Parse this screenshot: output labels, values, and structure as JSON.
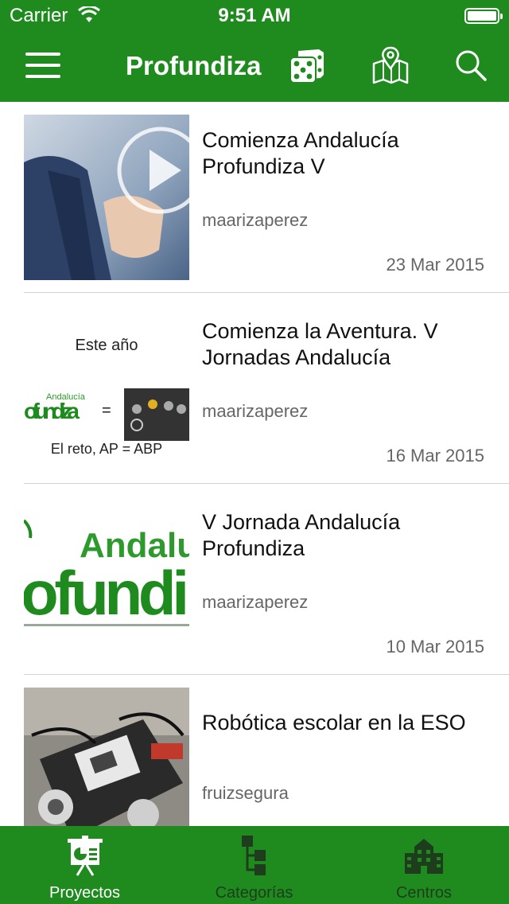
{
  "status_bar": {
    "carrier": "Carrier",
    "time": "9:51 AM"
  },
  "header": {
    "title": "Profundiza",
    "icons": [
      "menu-icon",
      "dice-icon",
      "map-icon",
      "search-icon"
    ]
  },
  "posts": [
    {
      "title": "Comienza Andalucía Profundiza V",
      "author": "maarizaperez",
      "date": "23 Mar 2015",
      "thumb": "video-touch"
    },
    {
      "title": "Comienza la Aventura. V Jornadas Andalucía",
      "author": "maarizaperez",
      "date": "16 Mar 2015",
      "thumb": "este-ano",
      "thumb_text": {
        "top": "Este año",
        "logo_small": "Andalucía",
        "logo_big": "ofundiza",
        "equals": "=",
        "bottom": "El reto, AP = ABP"
      }
    },
    {
      "title": "V Jornada Andalucía Profundiza",
      "author": "maarizaperez",
      "date": "10 Mar 2015",
      "thumb": "logo",
      "thumb_text": {
        "line1": "Andalucí",
        "line2": "ofundi"
      }
    },
    {
      "title": "Robótica escolar en la ESO",
      "author": "fruizsegura",
      "date": "",
      "thumb": "robot"
    }
  ],
  "tabs": [
    {
      "label": "Proyectos",
      "icon": "presentation-icon",
      "active": true
    },
    {
      "label": "Categorías",
      "icon": "hierarchy-icon",
      "active": false
    },
    {
      "label": "Centros",
      "icon": "buildings-icon",
      "active": false
    }
  ],
  "colors": {
    "brand": "#1f8b1f",
    "inactive_tab": "#1d3d1d",
    "text_secondary": "#666666"
  }
}
